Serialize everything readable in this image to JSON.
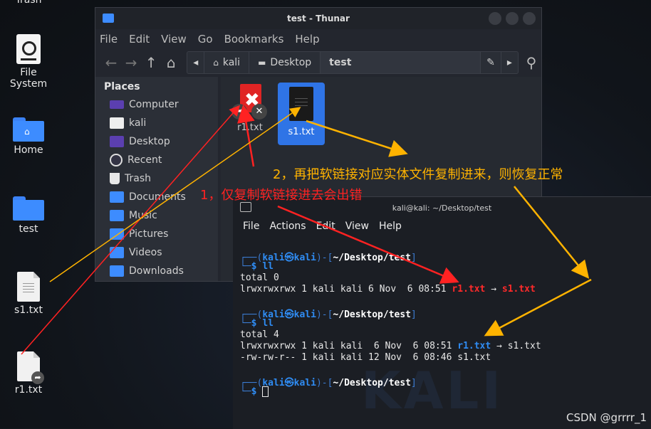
{
  "desktop": {
    "trash_partial": "Trash",
    "filesystem_label": "File System",
    "home_label": "Home",
    "test_label": "test",
    "s1_label": "s1.txt",
    "r1_label": "r1.txt"
  },
  "thunar": {
    "title": "test - Thunar",
    "menu": [
      "File",
      "Edit",
      "View",
      "Go",
      "Bookmarks",
      "Help"
    ],
    "path": [
      "kali",
      "Desktop",
      "test"
    ],
    "places_header": "Places",
    "places": [
      "Computer",
      "kali",
      "Desktop",
      "Recent",
      "Trash",
      "Documents",
      "Music",
      "Pictures",
      "Videos",
      "Downloads"
    ],
    "files": [
      "r1.txt",
      "s1.txt"
    ]
  },
  "terminal": {
    "title": "kali@kali: ~/Desktop/test",
    "menu": [
      "File",
      "Actions",
      "Edit",
      "View",
      "Help"
    ],
    "watermark": "KALI",
    "block1": {
      "prompt_user": "kali㉿kali",
      "prompt_path": "~/Desktop/test",
      "cmd": "ll",
      "total": "total 0",
      "row_prefix": "lrwxrwxrwx 1 kali kali 6 Nov  6 08:51 ",
      "link_name": "r1.txt",
      "arrow": " → ",
      "target": "s1.txt"
    },
    "block2": {
      "prompt_user": "kali㉿kali",
      "prompt_path": "~/Desktop/test",
      "cmd": "ll",
      "total": "total 4",
      "row1_prefix": "lrwxrwxrwx 1 kali kali  6 Nov  6 08:51 ",
      "row1_link": "r1.txt",
      "row1_rest": " → s1.txt",
      "row2": "-rw-rw-r-- 1 kali kali 12 Nov  6 08:46 s1.txt"
    },
    "block3": {
      "prompt_user": "kali㉿kali",
      "prompt_path": "~/Desktop/test"
    }
  },
  "annotations": {
    "a1": "1，仅复制软链接进去会出错",
    "a2": "2，再把软链接对应实体文件复制进来，则恢复正常",
    "a1_color": "#ff2222",
    "a2_color": "#ffb300"
  },
  "credit": "CSDN @grrrr_1"
}
